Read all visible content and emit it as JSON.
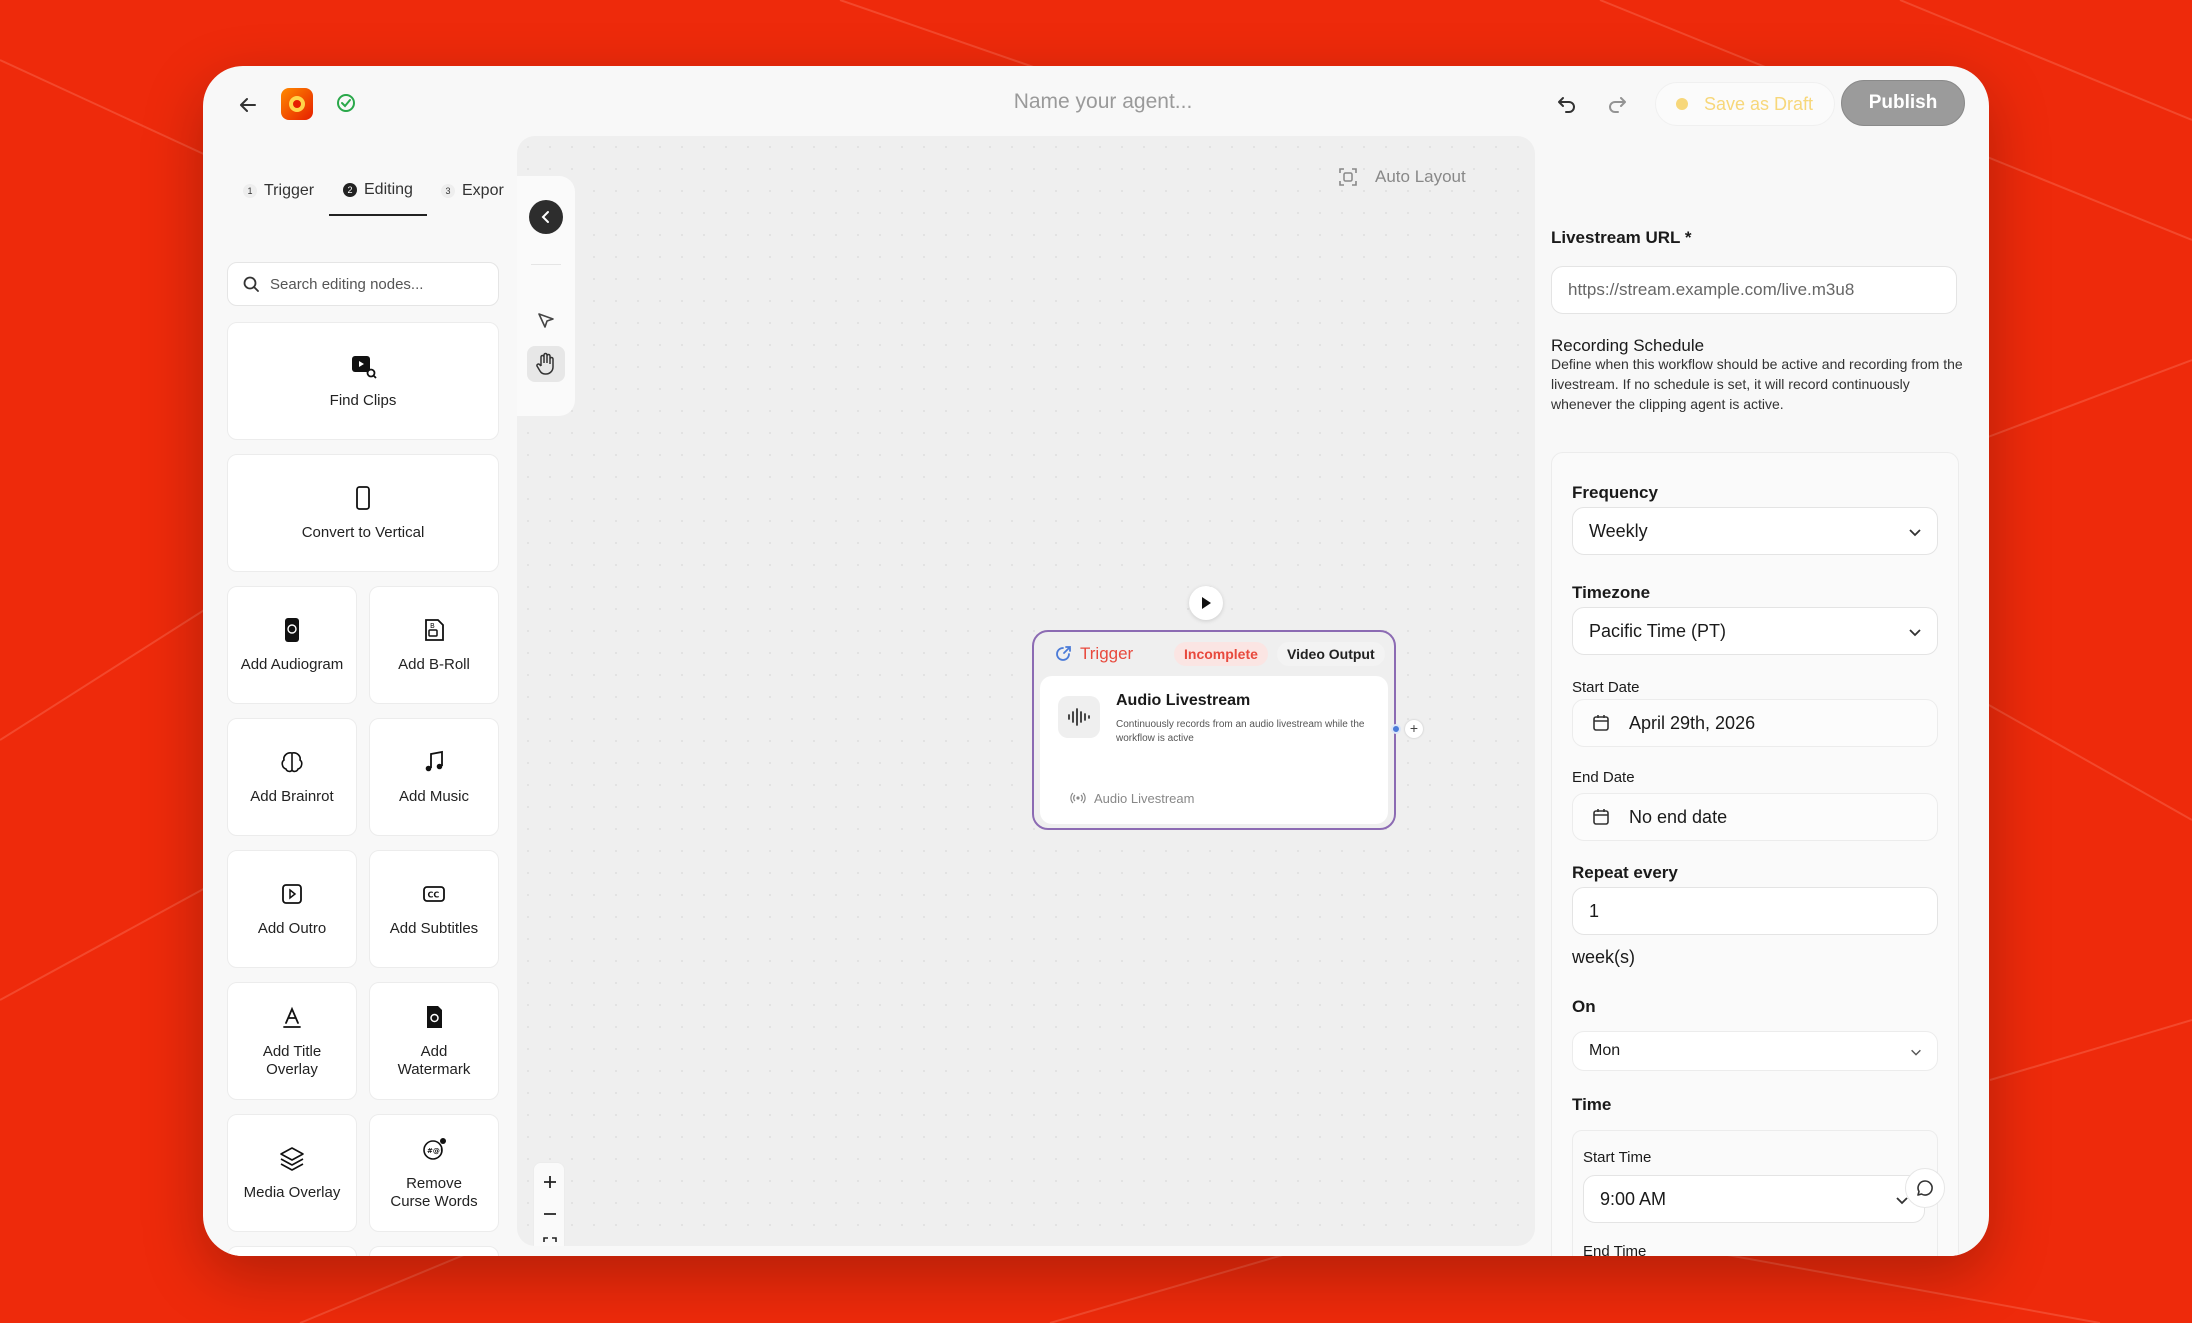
{
  "header": {
    "agent_name_placeholder": "Name your agent...",
    "save_draft_label": "Save as Draft",
    "publish_label": "Publish"
  },
  "tabs": [
    {
      "num": "1",
      "label": "Trigger"
    },
    {
      "num": "2",
      "label": "Editing"
    },
    {
      "num": "3",
      "label": "Expor"
    }
  ],
  "search": {
    "placeholder": "Search editing nodes..."
  },
  "nodes": {
    "find_clips": "Find Clips",
    "convert_vertical": "Convert to Vertical",
    "add_audiogram": "Add Audiogram",
    "add_broll": "Add B-Roll",
    "add_brainrot": "Add Brainrot",
    "add_music": "Add Music",
    "add_outro": "Add Outro",
    "add_subtitles": "Add Subtitles",
    "add_title_overlay": "Add Title Overlay",
    "add_watermark": "Add Watermark",
    "media_overlay": "Media Overlay",
    "remove_curse_words": "Remove Curse Words"
  },
  "canvas": {
    "auto_layout_label": "Auto Layout",
    "trigger_node": {
      "title": "Trigger",
      "status": "Incomplete",
      "output": "Video Output",
      "name": "Audio Livestream",
      "description": "Continuously records from an audio livestream while the workflow is active",
      "sub_label": "Audio Livestream"
    }
  },
  "settings": {
    "url_label": "Livestream URL *",
    "url_placeholder": "https://stream.example.com/live.m3u8",
    "schedule_title": "Recording Schedule",
    "schedule_desc": "Define when this workflow should be active and recording from the livestream. If no schedule is set, it will record continuously whenever the clipping agent is active.",
    "frequency_label": "Frequency",
    "frequency_value": "Weekly",
    "timezone_label": "Timezone",
    "timezone_value": "Pacific Time (PT)",
    "start_date_label": "Start Date",
    "start_date_value": "April 29th, 2026",
    "end_date_label": "End Date",
    "end_date_value": "No end date",
    "repeat_label": "Repeat every",
    "repeat_value": "1",
    "repeat_unit": "week(s)",
    "on_label": "On",
    "on_value": "Mon",
    "time_label": "Time",
    "start_time_label": "Start Time",
    "start_time_value": "9:00 AM",
    "end_time_label": "End Time"
  },
  "colors": {
    "background": "#ee2a0b",
    "trigger_accent": "#e8493d",
    "node_border": "#8c6bb3",
    "draft": "#f7d77a",
    "publish": "#9b9b9b"
  }
}
